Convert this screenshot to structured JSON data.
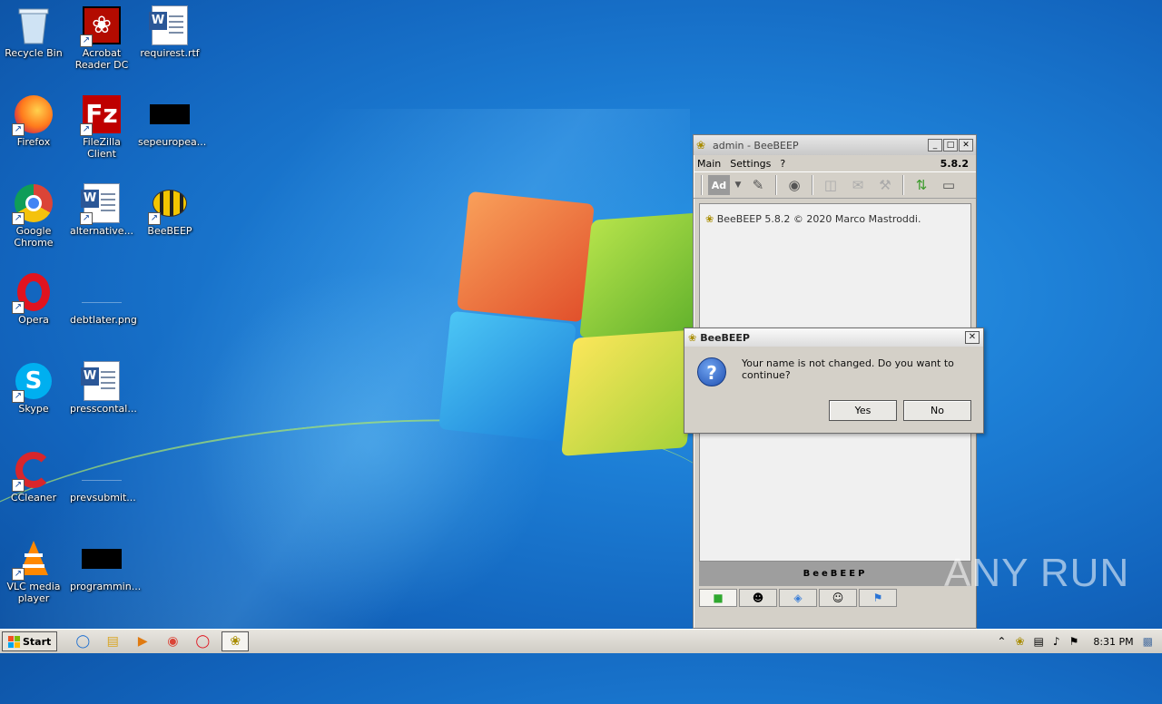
{
  "desktop": {
    "icons": [
      {
        "label": "Recycle Bin",
        "icon": "recycle-bin-icon"
      },
      {
        "label": "Acrobat Reader DC",
        "icon": "acrobat-icon"
      },
      {
        "label": "requirest.rtf",
        "icon": "word-doc-icon"
      },
      {
        "label": "Firefox",
        "icon": "firefox-icon"
      },
      {
        "label": "FileZilla Client",
        "icon": "filezilla-icon"
      },
      {
        "label": "sepeuropea...",
        "icon": "black-file-icon"
      },
      {
        "label": "Google Chrome",
        "icon": "chrome-icon"
      },
      {
        "label": "alternative...",
        "icon": "word-doc-icon"
      },
      {
        "label": "BeeBEEP",
        "icon": "bee-icon"
      },
      {
        "label": "Opera",
        "icon": "opera-icon"
      },
      {
        "label": "debtlater.png",
        "icon": "image-file-icon"
      },
      {
        "label": "Skype",
        "icon": "skype-icon"
      },
      {
        "label": "presscontal...",
        "icon": "word-doc-icon"
      },
      {
        "label": "CCleaner",
        "icon": "ccleaner-icon"
      },
      {
        "label": "prevsubmit...",
        "icon": "blank-file-icon"
      },
      {
        "label": "VLC media player",
        "icon": "vlc-icon"
      },
      {
        "label": "programmin...",
        "icon": "black-file-icon"
      }
    ]
  },
  "beebeep": {
    "title": "admin - BeeBEEP",
    "menu": [
      "Main",
      "Settings",
      "?"
    ],
    "version": "5.8.2",
    "toolbar_ad": "Ad",
    "chat_line": "BeeBEEP 5.8.2 © 2020 Marco Mastroddi.",
    "banner": "BeeBEEP"
  },
  "dialog": {
    "title": "BeeBEEP",
    "message": "Your name is not changed. Do you want to continue?",
    "yes": "Yes",
    "no": "No"
  },
  "taskbar": {
    "start": "Start",
    "clock": "8:31 PM"
  },
  "watermark": "ANY RUN"
}
